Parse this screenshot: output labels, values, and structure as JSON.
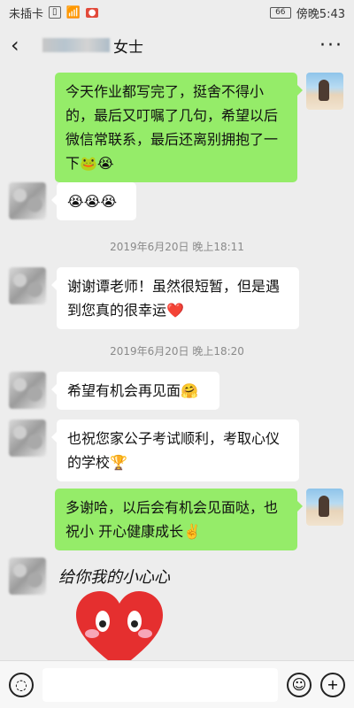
{
  "status": {
    "carrier": "未插卡",
    "battery": "66",
    "time": "傍晚5:43"
  },
  "header": {
    "title": "女士",
    "back_icon": "back-arrow-icon",
    "more_icon": "more-dots-icon"
  },
  "messages": [
    {
      "side": "right",
      "lines": [
        "今天作业都写完了，挺舍不得小",
        "的，最后又叮嘱了几句，希望以后",
        "微信常联系，最后还离别拥抱了一",
        "下🐸😭"
      ]
    },
    {
      "side": "left",
      "lines": [
        "😭😭😭"
      ]
    },
    {
      "time": "2019年6月20日 晚上18:11"
    },
    {
      "side": "left",
      "lines": [
        "谢谢谭老师！虽然很短暂，但是遇",
        "到您真的很幸运❤️"
      ]
    },
    {
      "time": "2019年6月20日 晚上18:20"
    },
    {
      "side": "left",
      "lines": [
        "希望有机会再见面🤗"
      ]
    },
    {
      "side": "left",
      "lines": [
        "也祝您家公子考试顺利，考取心仪",
        "的学校🏆"
      ]
    },
    {
      "side": "right",
      "lines": [
        "多谢哈，以后会有机会见面哒，也",
        "祝小 开心健康成长✌️"
      ]
    }
  ],
  "sticker": {
    "caption": "给你我的小心心"
  },
  "input": {
    "voice_icon": "voice-icon",
    "emoji_icon": "emoji-icon",
    "plus_icon": "plus-icon",
    "value": ""
  }
}
